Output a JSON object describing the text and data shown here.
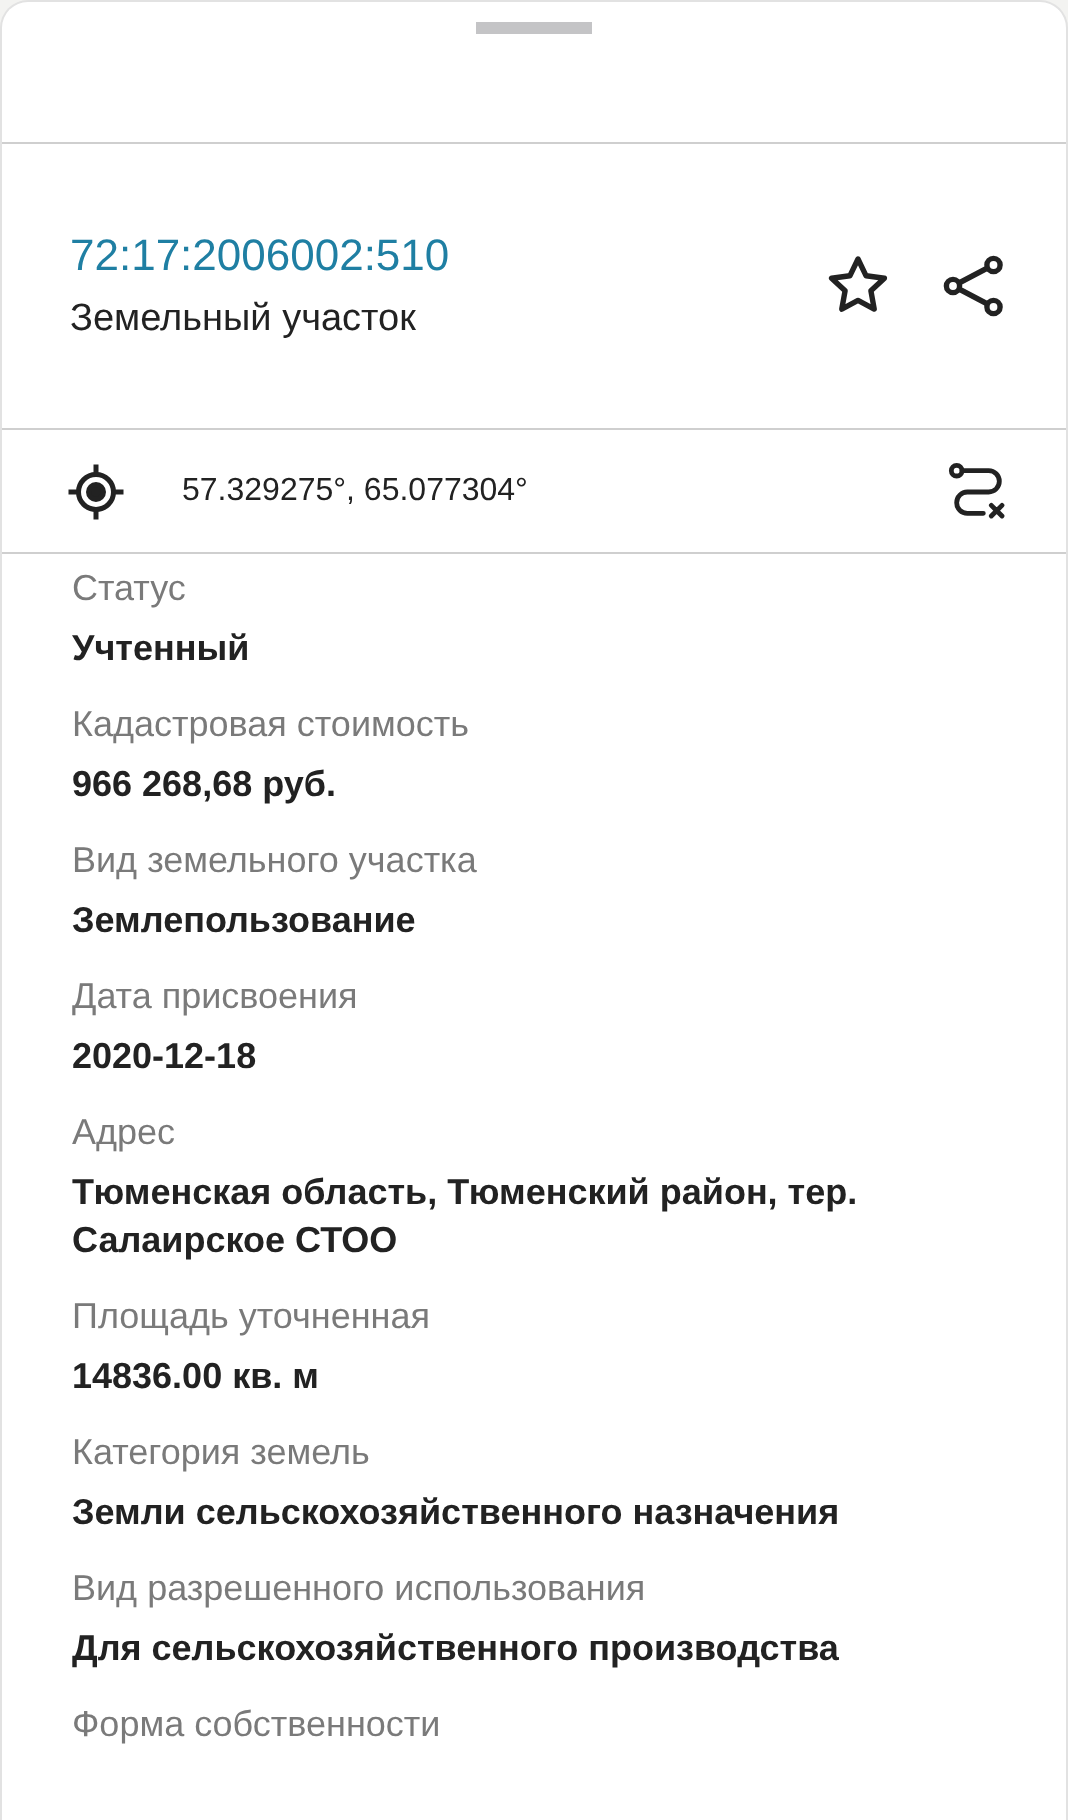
{
  "header": {
    "cadastral_number": "72:17:2006002:510",
    "object_type": "Земельный участок"
  },
  "coordinates": "57.329275°, 65.077304°",
  "fields": [
    {
      "label": "Статус",
      "value": "Учтенный"
    },
    {
      "label": "Кадастровая стоимость",
      "value": "966 268,68 руб."
    },
    {
      "label": "Вид земельного участка",
      "value": "Землепользование"
    },
    {
      "label": "Дата присвоения",
      "value": "2020-12-18"
    },
    {
      "label": "Адрес",
      "value": "Тюменская область, Тюменский район, тер. Салаирское СТОО"
    },
    {
      "label": "Площадь уточненная",
      "value": "14836.00 кв. м"
    },
    {
      "label": "Категория земель",
      "value": "Земли сельскохозяйственного назначения"
    },
    {
      "label": "Вид разрешенного использования",
      "value": "Для сельскохозяйственного производства"
    },
    {
      "label": "Форма собственности"
    }
  ]
}
